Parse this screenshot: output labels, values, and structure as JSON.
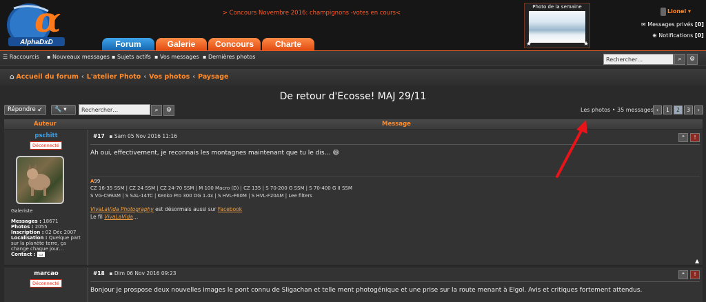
{
  "header": {
    "logo_text": "AlphaDxD",
    "promo": "> Concours Novembre 2016: champignons -votes en cours<",
    "tabs": [
      "Forum",
      "Galerie",
      "Concours",
      "Charte"
    ],
    "photo_of_week_title": "Photo de la semaine",
    "user_name": "Lionel",
    "messages_label": "Messages privés",
    "messages_count": "[0]",
    "notifications_label": "Notifications",
    "notifications_count": "[0]"
  },
  "navbar": {
    "links": [
      "Raccourcis",
      "Nouveaux messages",
      "Sujets actifs",
      "Vos messages",
      "Dernières photos"
    ],
    "search_placeholder": "Rechercher…"
  },
  "breadcrumb": [
    "Accueil du forum",
    "L'atelier Photo",
    "Vos photos",
    "Paysage"
  ],
  "topic": {
    "title": "De retour d'Ecosse! MAJ 29/11",
    "reply_label": "Répondre",
    "search_placeholder": "Rechercher…",
    "count_label": "Les photos",
    "count_value": "• 35 messages",
    "pages": [
      "1",
      "2",
      "3"
    ],
    "current_page": "2"
  },
  "table": {
    "col_author": "Auteur",
    "col_message": "Message"
  },
  "posts": [
    {
      "author": "pschitt",
      "status": "Déconnecté",
      "role": "Galeriste",
      "messages_label": "Messages :",
      "messages": "18671",
      "photos_label": "Photos :",
      "photos": "2055",
      "inscription_label": "Inscription :",
      "inscription": "02 Déc 2007",
      "localisation_label": "Localisation :",
      "localisation_line1": "Quelque part",
      "localisation_line2": "sur la planète terre, ça",
      "localisation_line3": "change chaque jour…",
      "contact_label": "Contact :",
      "num": "#17",
      "date": "Sam 05 Nov 2016 11:16",
      "text": "Ah oui, effectivement, je reconnais les montagnes maintenant que tu le dis… 😄",
      "sig_brand_a": "A",
      "sig_brand_rest": "99",
      "sig_line1": "CZ 16-35 SSM | CZ 24 SSM | CZ 24-70 SSM | M 100 Macro (D) | CZ 135 | S 70-200 G SSM | S 70-400 G II SSM",
      "sig_line2": "S VG-C99AM | S SAL-14TC | Kenko Pro 300 DG 1.4x | S HVL-F60M | S HVL-F20AM | Lee filters",
      "sig_vivalavida": "VivaLaVida Photography",
      "sig_mid": " est désormais aussi sur ",
      "sig_facebook": "Facebook",
      "sig_fil": "Le fil ",
      "sig_fil_link": "VivaLaVida",
      "sig_fil_end": "…"
    },
    {
      "author": "marcao",
      "status": "Déconnecté",
      "num": "#18",
      "date": "Dim 06 Nov 2016 09:23",
      "text": "Bonjour je prospose deux nouvelles images le pont connu de Sligachan et telle ment photogénique et une prise sur la route menant à Elgol. Avis et critiques fortement attendus."
    }
  ],
  "icons": {
    "quote": "❝",
    "report": "!",
    "search": "🔍",
    "gear": "⚙"
  },
  "colors": {
    "accent_orange": "#ff8a2a",
    "tab_blue": "#2a86d0",
    "username_blue": "#3ba0e8",
    "annotation_red": "#e8141a"
  }
}
